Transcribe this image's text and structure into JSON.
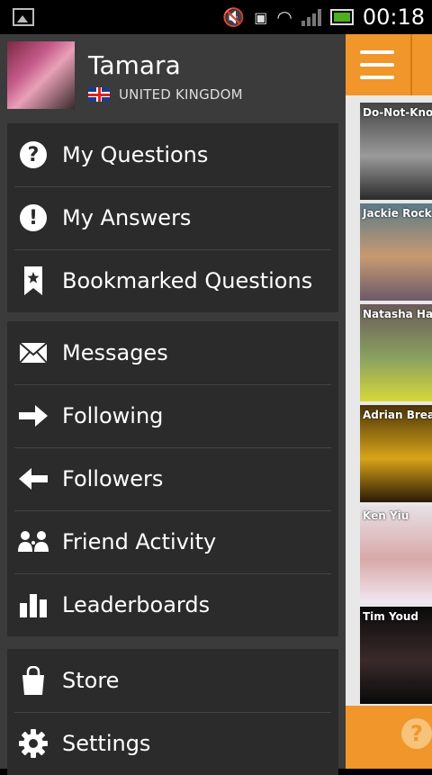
{
  "status_bar": {
    "time": "00:18"
  },
  "profile": {
    "name": "Tamara",
    "country": "UNITED KINGDOM"
  },
  "menu_groups": [
    [
      {
        "label": "My Questions",
        "icon": "question-circle-icon"
      },
      {
        "label": "My Answers",
        "icon": "exclamation-circle-icon"
      },
      {
        "label": "Bookmarked Questions",
        "icon": "bookmark-star-icon"
      }
    ],
    [
      {
        "label": "Messages",
        "icon": "envelope-icon"
      },
      {
        "label": "Following",
        "icon": "arrow-right-icon"
      },
      {
        "label": "Followers",
        "icon": "arrow-left-icon"
      },
      {
        "label": "Friend Activity",
        "icon": "people-icon"
      },
      {
        "label": "Leaderboards",
        "icon": "bar-chart-icon"
      }
    ],
    [
      {
        "label": "Store",
        "icon": "shopping-bag-icon"
      },
      {
        "label": "Settings",
        "icon": "gear-icon"
      }
    ]
  ],
  "feed": [
    {
      "name": "Do-Not-Know",
      "colors": [
        "#444444",
        "#9a9a9a",
        "#2a2a2a"
      ]
    },
    {
      "name": "Jackie Rock",
      "colors": [
        "#5a7a8a",
        "#c89a70",
        "#6b5a6a"
      ]
    },
    {
      "name": "Natasha Hall-M",
      "colors": [
        "#6a5a5a",
        "#8aa060",
        "#d6d83a"
      ]
    },
    {
      "name": "Adrian Brearley",
      "colors": [
        "#4a3308",
        "#d8a418",
        "#2a1a06"
      ]
    },
    {
      "name": "Ken Yiu",
      "colors": [
        "#e6e0e6",
        "#d8a8a8",
        "#f2e8f2"
      ]
    },
    {
      "name": "Tim Youd",
      "colors": [
        "#0a0a0a",
        "#3a2a2a",
        "#0a0a0a"
      ]
    }
  ]
}
